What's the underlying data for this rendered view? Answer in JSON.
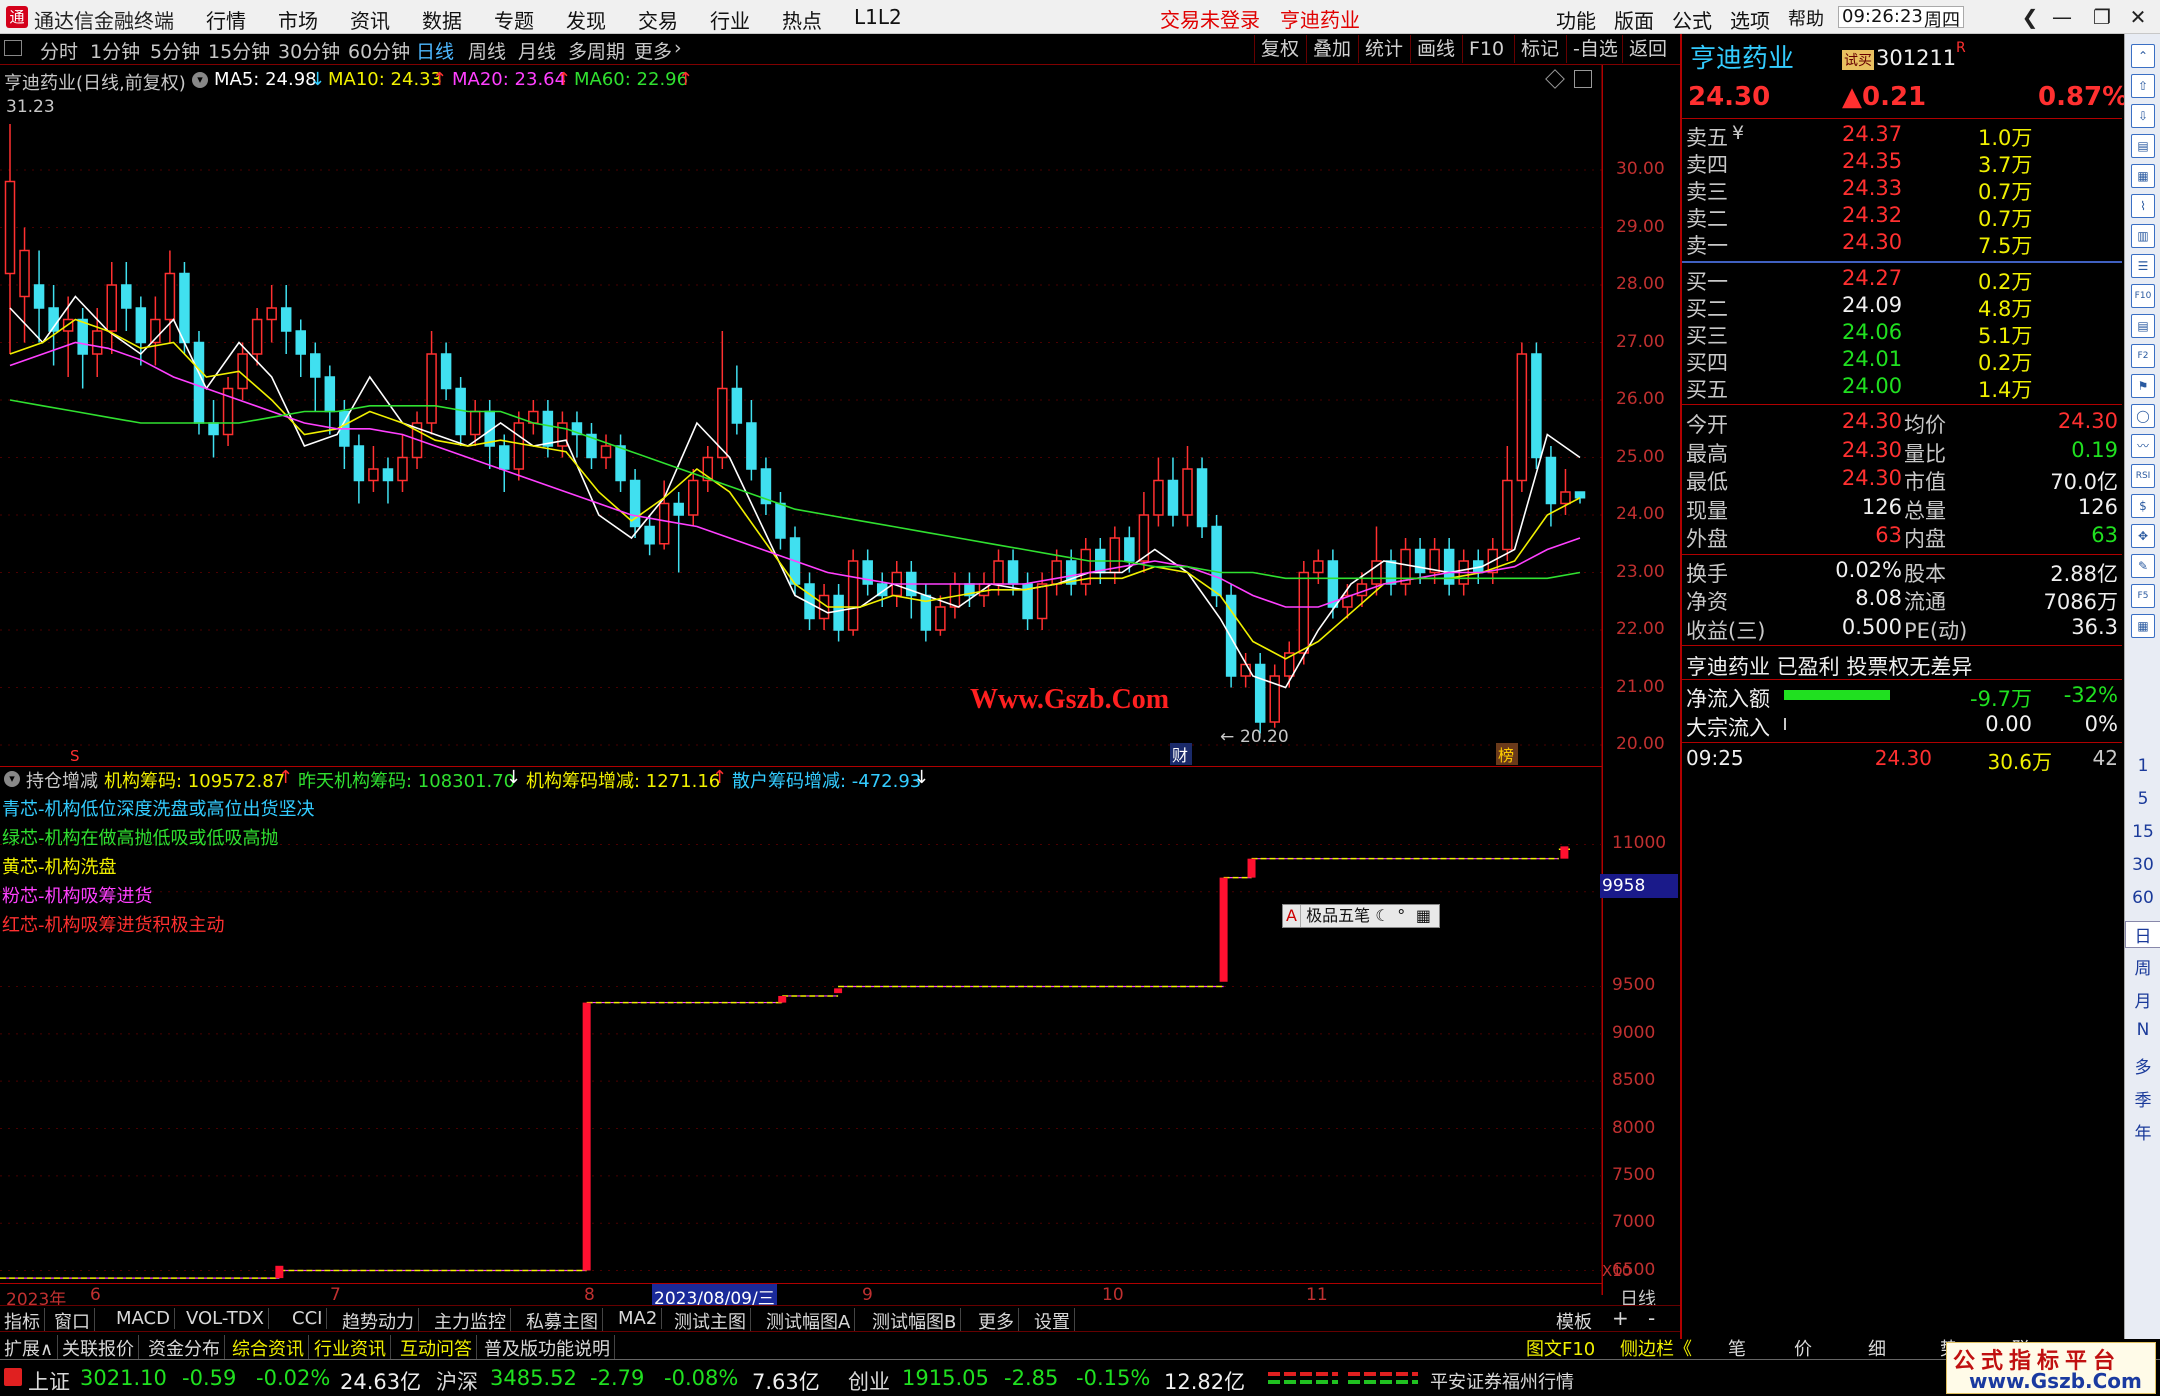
{
  "titlebar": {
    "app_title": "通达信金融终端",
    "menu": [
      "行情",
      "市场",
      "资讯",
      "数据",
      "专题",
      "发现",
      "交易",
      "行业",
      "热点",
      "L1L2"
    ],
    "trade_status": "交易未登录",
    "stock_link": "亨迪药业",
    "right_menu": [
      "功能",
      "版面",
      "公式",
      "选项",
      "帮助"
    ],
    "time": "09:26:23",
    "weekday": "周四"
  },
  "periodbar": {
    "periods": [
      "分时",
      "1分钟",
      "5分钟",
      "15分钟",
      "30分钟",
      "60分钟",
      "日线",
      "周线",
      "月线",
      "多周期",
      "更多"
    ],
    "active": "日线",
    "tools": [
      "复权",
      "叠加",
      "统计",
      "画线",
      "F10",
      "标记",
      "-自选",
      "返回"
    ]
  },
  "main_chart": {
    "title": "亨迪药业(日线,前复权)",
    "ma5": "MA5: 24.98",
    "ma10": "MA10: 24.33",
    "ma20": "MA20: 23.64",
    "ma60": "MA60: 22.96",
    "high_mark": "31.23",
    "low_mark": "20.20",
    "watermark": "Www.Gszb.Com",
    "event_markers": [
      "S",
      "财",
      "榜"
    ],
    "y_ticks": [
      "30.00",
      "29.00",
      "28.00",
      "27.00",
      "26.00",
      "25.00",
      "24.00",
      "23.00",
      "22.00",
      "21.00",
      "20.00"
    ]
  },
  "sub_chart": {
    "title": "持仓增减",
    "v1": "机构筹码: 109572.87",
    "v2": "昨天机构筹码: 108301.70",
    "v3": "机构筹码增减: 1271.16",
    "v4": "散户筹码增减: -472.93",
    "legend": [
      "青芯-机构低位深度洗盘或高位出货坚决",
      "绿芯-机构在做高抛低吸或低吸高抛",
      "黄芯-机构洗盘",
      "粉芯-机构吸筹进货",
      "红芯-机构吸筹进货积极主动"
    ],
    "y_ticks": [
      "11000",
      "10500",
      "9958",
      "9500",
      "9000",
      "8500",
      "8000",
      "7500",
      "7000",
      "6500"
    ],
    "y_unit": "X10",
    "current_value": "9958",
    "popup": "极品五笔"
  },
  "x_axis": {
    "labels": [
      "2023年",
      "6",
      "7",
      "8",
      "2023/08/09/三",
      "9",
      "10",
      "11"
    ],
    "right_label": "日线"
  },
  "bottom_tabs": {
    "row1": [
      "指标",
      "窗口",
      "MACD",
      "VOL-TDX",
      "CCI",
      "趋势动力",
      "主力监控",
      "私募主图",
      "MA2",
      "测试主图",
      "测试幅图A",
      "测试幅图B",
      "更多",
      "设置"
    ],
    "row1_right": [
      "模板",
      "+",
      "-"
    ],
    "row2": [
      "扩展∧",
      "关联报价",
      "资金分布",
      "综合资讯",
      "行业资讯",
      "互动问答",
      "普及版功能说明"
    ],
    "row2_right": [
      "图文F10",
      "侧边栏《",
      "笔",
      "价",
      "细",
      "势",
      "联"
    ]
  },
  "quote": {
    "name": "亨迪药业",
    "badge": "试买",
    "code": "301211",
    "flag": "R",
    "price": "24.30",
    "change": "▲0.21",
    "pct": "0.87%",
    "asks": [
      {
        "label": "卖五",
        "tag": "¥",
        "price": "24.37",
        "vol": "1.0万"
      },
      {
        "label": "卖四",
        "price": "24.35",
        "vol": "3.7万"
      },
      {
        "label": "卖三",
        "price": "24.33",
        "vol": "0.7万"
      },
      {
        "label": "卖二",
        "price": "24.32",
        "vol": "0.7万"
      },
      {
        "label": "卖一",
        "price": "24.30",
        "vol": "7.5万"
      }
    ],
    "bids": [
      {
        "label": "买一",
        "price": "24.27",
        "vol": "0.2万",
        "color": "#ff3030"
      },
      {
        "label": "买二",
        "price": "24.09",
        "vol": "4.8万",
        "color": "#f0f0f0"
      },
      {
        "label": "买三",
        "price": "24.06",
        "vol": "5.1万",
        "color": "#20e020"
      },
      {
        "label": "买四",
        "price": "24.01",
        "vol": "0.2万",
        "color": "#20e020"
      },
      {
        "label": "买五",
        "price": "24.00",
        "vol": "1.4万",
        "color": "#20e020"
      }
    ],
    "stats": [
      {
        "l1": "今开",
        "v1": "24.30",
        "c1": "#ff3030",
        "l2": "均价",
        "v2": "24.30",
        "c2": "#ff3030"
      },
      {
        "l1": "最高",
        "v1": "24.30",
        "c1": "#ff3030",
        "l2": "量比",
        "v2": "0.19",
        "c2": "#20e020"
      },
      {
        "l1": "最低",
        "v1": "24.30",
        "c1": "#ff3030",
        "l2": "市值",
        "v2": "70.0亿",
        "c2": "#f0f0f0"
      },
      {
        "l1": "现量",
        "v1": "126",
        "c1": "#f0f0f0",
        "l2": "总量",
        "v2": "126",
        "c2": "#f0f0f0"
      },
      {
        "l1": "外盘",
        "v1": "63",
        "c1": "#ff3030",
        "l2": "内盘",
        "v2": "63",
        "c2": "#20e020"
      }
    ],
    "stats2": [
      {
        "l1": "换手",
        "v1": "0.02%",
        "l2": "股本",
        "v2": "2.88亿"
      },
      {
        "l1": "净资",
        "v1": "8.08",
        "l2": "流通",
        "v2": "7086万"
      },
      {
        "l1": "收益(三)",
        "v1": "0.500",
        "l2": "PE(动)",
        "v2": "36.3"
      }
    ],
    "profile": "亨迪药业 已盈利 投票权无差异",
    "netflow_label": "净流入额",
    "netflow_value": "-9.7万",
    "netflow_pct": "-32%",
    "block_label": "大宗流入",
    "block_value": "0.00",
    "block_pct": "0%",
    "tick_time": "09:25",
    "tick_price": "24.30",
    "tick_vol": "30.6万",
    "tick_num": "42"
  },
  "sidebar": {
    "icons": [
      "up-arrow-icon",
      "upload-icon",
      "download-icon",
      "chart-icon",
      "grid-icon",
      "line-icon",
      "bar-icon",
      "list-icon",
      "f10-icon",
      "doc-icon",
      "f2-icon",
      "fund-icon",
      "circle-icon",
      "trend-icon",
      "rsi-icon",
      "dollar-icon",
      "move-icon",
      "pencil-icon",
      "f5-icon",
      "table-icon"
    ],
    "labels": [
      "1",
      "5",
      "15",
      "30",
      "60",
      "日",
      "周",
      "月",
      "N",
      "多",
      "季",
      "年"
    ]
  },
  "status": {
    "sh_name": "上证",
    "sh_val": "3021.10",
    "sh_chg": "-0.59",
    "sh_pct": "-0.02%",
    "sh_amt": "24.63亿",
    "sz_name": "沪深",
    "sz_val": "3485.52",
    "sz_chg": "-2.79",
    "sz_pct": "-0.08%",
    "sz_amt": "7.63亿",
    "cy_name": "创业",
    "cy_val": "1915.05",
    "cy_chg": "-2.85",
    "cy_pct": "-0.15%",
    "cy_amt": "12.82亿",
    "broker": "平安证券福州行情"
  },
  "brand": {
    "line1": "公式指标平台",
    "line2": "www.Gszb.Com"
  },
  "chart_data": {
    "type": "candlestick",
    "price_ylim": [
      20.0,
      31.5
    ],
    "candles": [
      [
        28.2,
        29.8,
        26.8,
        30.8
      ],
      [
        27.8,
        28.6,
        27.0,
        29.0
      ],
      [
        28.0,
        27.6,
        27.0,
        28.6
      ],
      [
        27.6,
        27.2,
        26.6,
        28.0
      ],
      [
        27.2,
        27.4,
        26.4,
        27.8
      ],
      [
        27.4,
        26.8,
        26.2,
        27.6
      ],
      [
        26.8,
        27.2,
        26.4,
        27.6
      ],
      [
        27.2,
        28.0,
        26.8,
        28.4
      ],
      [
        28.0,
        27.6,
        27.2,
        28.4
      ],
      [
        27.6,
        27.0,
        26.6,
        27.8
      ],
      [
        27.0,
        27.4,
        26.6,
        27.8
      ],
      [
        27.4,
        28.2,
        27.0,
        28.6
      ],
      [
        28.2,
        27.0,
        26.8,
        28.4
      ],
      [
        27.0,
        25.6,
        25.4,
        27.2
      ],
      [
        25.6,
        25.4,
        25.0,
        26.0
      ],
      [
        25.4,
        26.2,
        25.2,
        26.4
      ],
      [
        26.2,
        26.8,
        26.0,
        27.0
      ],
      [
        26.8,
        27.4,
        26.6,
        27.6
      ],
      [
        27.4,
        27.6,
        27.0,
        28.0
      ],
      [
        27.6,
        27.2,
        26.8,
        28.0
      ],
      [
        27.2,
        26.8,
        26.4,
        27.4
      ],
      [
        26.8,
        26.4,
        25.8,
        27.0
      ],
      [
        26.4,
        25.8,
        25.4,
        26.6
      ],
      [
        25.8,
        25.2,
        24.8,
        26.0
      ],
      [
        25.2,
        24.6,
        24.2,
        25.4
      ],
      [
        24.6,
        24.8,
        24.4,
        25.2
      ],
      [
        24.8,
        24.6,
        24.2,
        25.0
      ],
      [
        24.6,
        25.0,
        24.4,
        25.4
      ],
      [
        25.0,
        25.6,
        24.8,
        25.8
      ],
      [
        25.6,
        26.8,
        25.4,
        27.2
      ],
      [
        26.8,
        26.2,
        26.0,
        27.0
      ],
      [
        26.2,
        25.4,
        25.2,
        26.4
      ],
      [
        25.4,
        25.8,
        25.2,
        26.0
      ],
      [
        25.8,
        25.2,
        24.8,
        26.0
      ],
      [
        25.2,
        24.8,
        24.4,
        25.4
      ],
      [
        24.8,
        25.6,
        24.6,
        25.8
      ],
      [
        25.6,
        25.8,
        25.4,
        26.0
      ],
      [
        25.8,
        25.2,
        25.0,
        26.0
      ],
      [
        25.2,
        25.6,
        25.0,
        25.8
      ],
      [
        25.6,
        25.4,
        25.0,
        25.8
      ],
      [
        25.4,
        25.0,
        24.8,
        25.6
      ],
      [
        25.0,
        25.2,
        24.8,
        25.4
      ],
      [
        25.2,
        24.6,
        24.4,
        25.4
      ],
      [
        24.6,
        23.8,
        23.6,
        24.8
      ],
      [
        23.8,
        23.5,
        23.3,
        24.0
      ],
      [
        23.5,
        24.2,
        23.4,
        24.6
      ],
      [
        24.2,
        24.0,
        23.0,
        24.4
      ],
      [
        24.0,
        24.6,
        23.8,
        24.8
      ],
      [
        24.6,
        25.0,
        24.4,
        25.2
      ],
      [
        25.0,
        26.2,
        24.8,
        27.2
      ],
      [
        26.2,
        25.6,
        25.4,
        26.6
      ],
      [
        25.6,
        24.8,
        24.6,
        26.0
      ],
      [
        24.8,
        24.2,
        24.0,
        25.0
      ],
      [
        24.2,
        23.6,
        23.4,
        24.4
      ],
      [
        23.6,
        22.8,
        22.6,
        23.8
      ],
      [
        22.8,
        22.2,
        22.0,
        23.0
      ],
      [
        22.2,
        22.6,
        22.0,
        22.8
      ],
      [
        22.6,
        22.0,
        21.8,
        22.8
      ],
      [
        22.0,
        23.2,
        21.9,
        23.4
      ],
      [
        23.2,
        22.8,
        22.6,
        23.4
      ],
      [
        22.8,
        22.6,
        22.4,
        23.0
      ],
      [
        22.6,
        23.0,
        22.4,
        23.2
      ],
      [
        23.0,
        22.6,
        22.2,
        23.2
      ],
      [
        22.6,
        22.0,
        21.8,
        22.8
      ],
      [
        22.0,
        22.4,
        21.9,
        22.6
      ],
      [
        22.4,
        22.8,
        22.2,
        23.0
      ],
      [
        22.8,
        22.6,
        22.4,
        23.0
      ],
      [
        22.6,
        22.8,
        22.4,
        23.0
      ],
      [
        22.8,
        23.2,
        22.6,
        23.4
      ],
      [
        23.2,
        22.8,
        22.6,
        23.4
      ],
      [
        22.8,
        22.2,
        22.0,
        23.0
      ],
      [
        22.2,
        22.8,
        22.0,
        23.0
      ],
      [
        22.8,
        23.2,
        22.6,
        23.4
      ],
      [
        23.2,
        22.8,
        22.6,
        23.4
      ],
      [
        22.8,
        23.4,
        22.6,
        23.6
      ],
      [
        23.4,
        23.0,
        22.8,
        23.6
      ],
      [
        23.0,
        23.6,
        22.8,
        23.8
      ],
      [
        23.6,
        23.2,
        23.0,
        23.8
      ],
      [
        23.2,
        24.0,
        23.0,
        24.4
      ],
      [
        24.0,
        24.6,
        23.8,
        25.0
      ],
      [
        24.6,
        24.0,
        23.8,
        25.0
      ],
      [
        24.0,
        24.8,
        23.8,
        25.2
      ],
      [
        24.8,
        23.8,
        23.6,
        25.0
      ],
      [
        23.8,
        22.6,
        22.4,
        24.0
      ],
      [
        22.6,
        21.2,
        21.0,
        22.8
      ],
      [
        21.2,
        21.4,
        21.0,
        21.6
      ],
      [
        21.4,
        20.4,
        20.2,
        21.6
      ],
      [
        20.4,
        21.2,
        20.3,
        21.4
      ],
      [
        21.2,
        21.6,
        21.0,
        21.8
      ],
      [
        21.6,
        23.0,
        21.4,
        23.2
      ],
      [
        23.0,
        23.2,
        22.8,
        23.4
      ],
      [
        23.2,
        22.4,
        22.2,
        23.4
      ],
      [
        22.4,
        22.6,
        22.2,
        22.8
      ],
      [
        22.6,
        22.8,
        22.4,
        23.0
      ],
      [
        22.8,
        23.2,
        22.6,
        23.8
      ],
      [
        23.2,
        22.8,
        22.6,
        23.4
      ],
      [
        22.8,
        23.4,
        22.6,
        23.6
      ],
      [
        23.4,
        23.0,
        22.8,
        23.6
      ],
      [
        23.0,
        23.4,
        22.8,
        23.6
      ],
      [
        23.4,
        22.8,
        22.6,
        23.6
      ],
      [
        22.8,
        23.2,
        22.6,
        23.4
      ],
      [
        23.2,
        23.0,
        22.8,
        23.4
      ],
      [
        23.0,
        23.4,
        22.8,
        23.6
      ],
      [
        23.4,
        24.6,
        23.2,
        25.2
      ],
      [
        24.6,
        26.8,
        24.4,
        27.0
      ],
      [
        26.8,
        25.0,
        24.8,
        27.0
      ],
      [
        25.0,
        24.2,
        23.8,
        25.2
      ],
      [
        24.2,
        24.4,
        24.0,
        24.8
      ],
      [
        24.4,
        24.3,
        24.2,
        24.4
      ]
    ],
    "ma": {
      "MA5": [
        27.6,
        27.0,
        27.8,
        27.2,
        26.8,
        27.4,
        26.2,
        27.0,
        26.4,
        25.2,
        25.4,
        26.4,
        25.6,
        25.4,
        25.2,
        25.6,
        25.2,
        25.3,
        24.0,
        23.6,
        24.3,
        25.6,
        25.0,
        23.8,
        22.6,
        22.3,
        22.4,
        22.8,
        22.6,
        22.4,
        22.8,
        22.7,
        22.8,
        23.0,
        23.0,
        23.4,
        23.0,
        22.2,
        21.2,
        21.0,
        22.0,
        22.8,
        23.2,
        23.1,
        23.0,
        23.1,
        23.4,
        25.4,
        25.0
      ],
      "MA10": [
        26.8,
        27.0,
        27.4,
        27.2,
        26.9,
        27.0,
        26.4,
        26.5,
        26.0,
        25.4,
        25.5,
        25.8,
        25.6,
        25.3,
        25.2,
        25.3,
        25.2,
        25.1,
        24.4,
        23.9,
        24.3,
        24.8,
        24.4,
        23.6,
        22.8,
        22.4,
        22.4,
        22.6,
        22.5,
        22.6,
        22.7,
        22.7,
        22.8,
        22.9,
        22.9,
        23.1,
        23.0,
        22.6,
        21.8,
        21.5,
        21.8,
        22.3,
        22.8,
        22.9,
        22.9,
        23.0,
        23.2,
        24.0,
        24.3
      ],
      "MA20": [
        26.6,
        26.8,
        27.0,
        26.9,
        26.7,
        26.4,
        26.2,
        26.0,
        25.8,
        25.6,
        25.5,
        25.5,
        25.4,
        25.2,
        25.0,
        24.8,
        24.6,
        24.4,
        24.2,
        24.0,
        23.9,
        23.8,
        23.6,
        23.4,
        23.2,
        23.0,
        22.9,
        22.8,
        22.8,
        22.8,
        22.8,
        22.8,
        22.9,
        23.0,
        23.1,
        23.2,
        23.1,
        22.9,
        22.6,
        22.4,
        22.4,
        22.6,
        22.8,
        22.9,
        23.0,
        23.0,
        23.1,
        23.4,
        23.6
      ],
      "MA60": [
        26.0,
        25.9,
        25.8,
        25.7,
        25.6,
        25.6,
        25.6,
        25.6,
        25.7,
        25.8,
        25.8,
        25.9,
        25.9,
        25.9,
        25.8,
        25.8,
        25.6,
        25.5,
        25.3,
        25.1,
        24.9,
        24.7,
        24.5,
        24.3,
        24.1,
        24.0,
        23.9,
        23.8,
        23.7,
        23.6,
        23.5,
        23.4,
        23.3,
        23.2,
        23.2,
        23.1,
        23.1,
        23.0,
        23.0,
        22.9,
        22.9,
        22.9,
        22.9,
        22.9,
        22.9,
        22.9,
        22.9,
        22.9,
        23.0
      ]
    },
    "holdings": {
      "ylim": [
        6500,
        11100
      ],
      "segments": [
        {
          "from": 0,
          "to": 50,
          "value": 6420
        },
        {
          "from": 50,
          "to": 105,
          "value": 6500
        },
        {
          "from": 105,
          "to": 140,
          "value": 9330
        },
        {
          "from": 140,
          "to": 150,
          "value": 9400
        },
        {
          "from": 150,
          "to": 219,
          "value": 9500
        },
        {
          "from": 219,
          "to": 224,
          "value": 10650
        },
        {
          "from": 224,
          "to": 279,
          "value": 10850
        },
        {
          "from": 279,
          "to": 281,
          "value": 10950
        }
      ],
      "bars": [
        {
          "x": 50,
          "from": 6420,
          "to": 6550
        },
        {
          "x": 105,
          "from": 6500,
          "to": 9330
        },
        {
          "x": 140,
          "from": 9330,
          "to": 9400
        },
        {
          "x": 150,
          "from": 9430,
          "to": 9480
        },
        {
          "x": 219,
          "from": 9550,
          "to": 10650
        },
        {
          "x": 224,
          "from": 10650,
          "to": 10850
        },
        {
          "x": 280,
          "from": 10850,
          "to": 10980
        }
      ]
    }
  }
}
